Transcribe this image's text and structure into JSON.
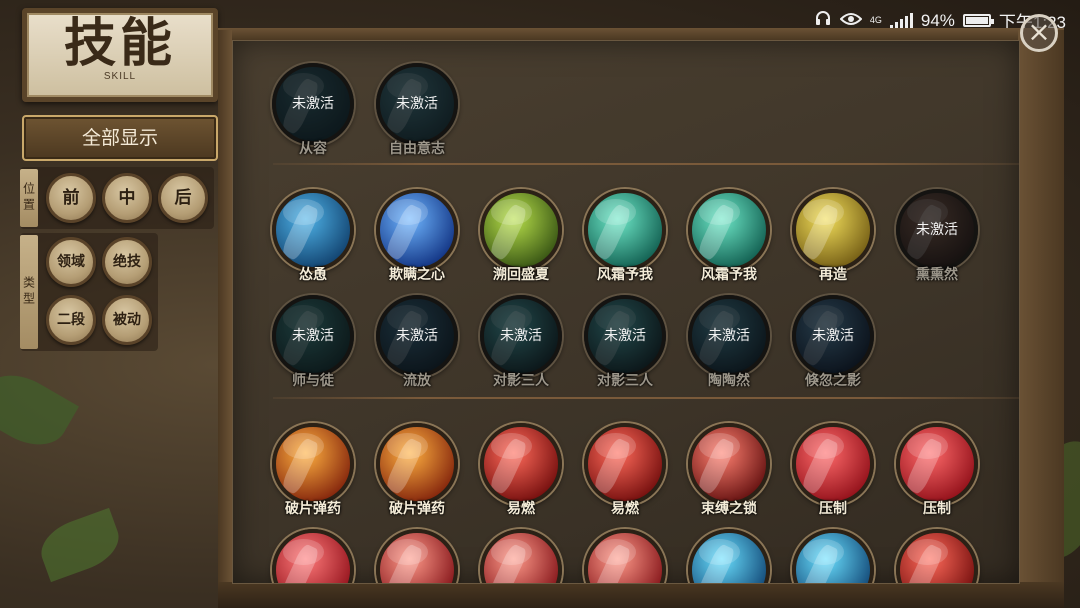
{
  "status_bar": {
    "network": "4G",
    "battery": "94%",
    "battery_level": 0.94,
    "time": "下午1:23"
  },
  "title": {
    "main": "技能",
    "sub": "SKILL"
  },
  "filters": {
    "show_all": "全部显示",
    "position": {
      "label": "位置",
      "options": [
        "前",
        "中",
        "后"
      ]
    },
    "type": {
      "label": "类型",
      "options": [
        "领域",
        "绝技",
        "二段",
        "被动"
      ]
    }
  },
  "locked_label": "未激活",
  "sections": [
    {
      "rows": [
        [
          {
            "name": "从容",
            "active": false,
            "colors": [
              "#2a5d6a",
              "#0e2a33"
            ]
          },
          {
            "name": "自由意志",
            "active": false,
            "colors": [
              "#3b7c8a",
              "#13333c"
            ]
          }
        ]
      ]
    },
    {
      "rows": [
        [
          {
            "name": "怂恿",
            "active": true,
            "colors": [
              "#4fb3e8",
              "#0d3a66"
            ]
          },
          {
            "name": "欺瞒之心",
            "active": true,
            "colors": [
              "#6fb6ff",
              "#0b2a7a"
            ]
          },
          {
            "name": "溯回盛夏",
            "active": true,
            "colors": [
              "#b8e04a",
              "#2e4a10"
            ]
          },
          {
            "name": "风霜予我",
            "active": true,
            "colors": [
              "#6ee8c8",
              "#0b5548"
            ]
          },
          {
            "name": "风霜予我",
            "active": true,
            "colors": [
              "#6ee8c8",
              "#0b5548"
            ]
          },
          {
            "name": "再造",
            "active": true,
            "colors": [
              "#f2de5a",
              "#6b5410"
            ]
          },
          {
            "name": "熏熏然",
            "active": false,
            "colors": [
              "#8b5a44",
              "#2a1610"
            ]
          }
        ],
        [
          {
            "name": "师与徒",
            "active": false,
            "colors": [
              "#2e8a88",
              "#0c2a2c"
            ]
          },
          {
            "name": "流放",
            "active": false,
            "colors": [
              "#2e6a8a",
              "#0c1e2c"
            ]
          },
          {
            "name": "对影三人",
            "active": false,
            "colors": [
              "#3ab0b4",
              "#0a1e24"
            ]
          },
          {
            "name": "对影三人",
            "active": false,
            "colors": [
              "#3ab0b4",
              "#0a1e24"
            ]
          },
          {
            "name": "陶陶然",
            "active": false,
            "colors": [
              "#3a8aa4",
              "#0a1e2c"
            ]
          },
          {
            "name": "倏忽之影",
            "active": false,
            "colors": [
              "#4a8ab4",
              "#0a1630"
            ]
          }
        ]
      ]
    },
    {
      "rows": [
        [
          {
            "name": "破片弹药",
            "active": true,
            "colors": [
              "#ffb040",
              "#7a1a08"
            ]
          },
          {
            "name": "破片弹药",
            "active": true,
            "colors": [
              "#ffb040",
              "#7a1a08"
            ]
          },
          {
            "name": "易燃",
            "active": true,
            "colors": [
              "#ff6a5a",
              "#6a0808"
            ]
          },
          {
            "name": "易燃",
            "active": true,
            "colors": [
              "#ff6a5a",
              "#6a0808"
            ]
          },
          {
            "name": "束缚之锁",
            "active": true,
            "colors": [
              "#ff8070",
              "#5a0a0a"
            ]
          },
          {
            "name": "压制",
            "active": true,
            "colors": [
              "#ff6a6a",
              "#8a0a14"
            ]
          },
          {
            "name": "压制",
            "active": true,
            "colors": [
              "#ff6a6a",
              "#8a0a14"
            ]
          }
        ],
        [
          {
            "name": "",
            "active": true,
            "colors": [
              "#ff7a7a",
              "#8a0a14"
            ]
          },
          {
            "name": "",
            "active": true,
            "colors": [
              "#ff9a8a",
              "#7a0a10"
            ]
          },
          {
            "name": "",
            "active": true,
            "colors": [
              "#ff9a8a",
              "#7a0a10"
            ]
          },
          {
            "name": "",
            "active": true,
            "colors": [
              "#ff9a8a",
              "#7a0a10"
            ]
          },
          {
            "name": "",
            "active": true,
            "colors": [
              "#6ae0ff",
              "#0a3a6a"
            ]
          },
          {
            "name": "",
            "active": true,
            "colors": [
              "#6ae0ff",
              "#0a3a6a"
            ]
          },
          {
            "name": "",
            "active": true,
            "colors": [
              "#ff6a5a",
              "#6a0808"
            ]
          }
        ]
      ]
    }
  ]
}
